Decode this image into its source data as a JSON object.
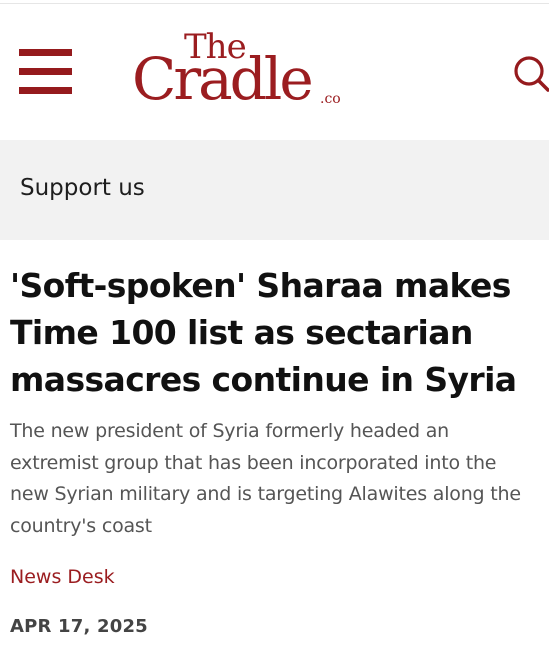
{
  "header": {
    "logo": {
      "line1": "The",
      "line2": "Cradle",
      "suffix": ".co"
    },
    "menu_icon": "hamburger-menu-icon",
    "search_icon": "search-icon",
    "brand_color": "#9b1d20"
  },
  "support": {
    "label": "Support us",
    "background": "#f2f2f2"
  },
  "article": {
    "headline": "'Soft-spoken' Sharaa makes Time 100 list as sectarian massacres continue in Syria",
    "dek": "The new president of Syria formerly headed an extremist group that has been incorporated into the new Syrian military and is targeting Alawites along the country's coast",
    "author": "News Desk",
    "date": "APR 17, 2025"
  }
}
